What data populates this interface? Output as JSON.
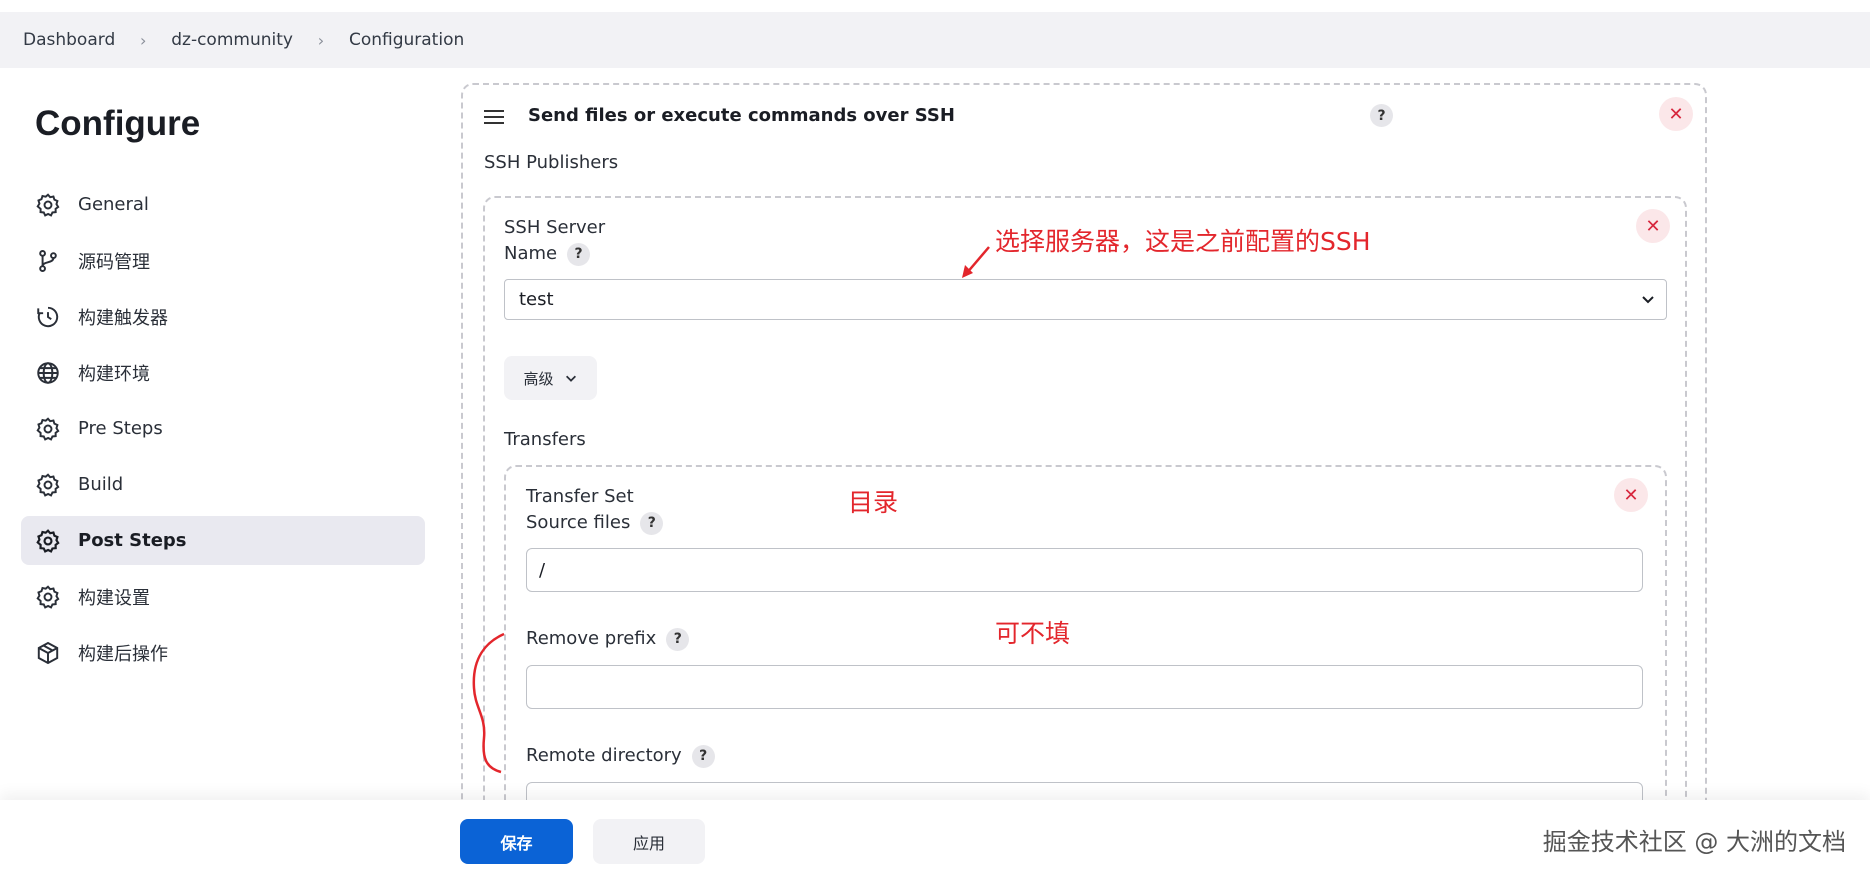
{
  "breadcrumb": [
    "Dashboard",
    "dz-community",
    "Configuration"
  ],
  "page_title": "Configure",
  "sidebar": {
    "items": [
      {
        "label": "General",
        "icon": "gear-icon",
        "active": false
      },
      {
        "label": "源码管理",
        "icon": "branch-icon",
        "active": false
      },
      {
        "label": "构建触发器",
        "icon": "clock-icon",
        "active": false
      },
      {
        "label": "构建环境",
        "icon": "globe-icon",
        "active": false
      },
      {
        "label": "Pre Steps",
        "icon": "gear-icon",
        "active": false
      },
      {
        "label": "Build",
        "icon": "gear-icon",
        "active": false
      },
      {
        "label": "Post Steps",
        "icon": "gear-icon",
        "active": true
      },
      {
        "label": "构建设置",
        "icon": "gear-icon",
        "active": false
      },
      {
        "label": "构建后操作",
        "icon": "package-icon",
        "active": false
      }
    ]
  },
  "panel": {
    "title": "Send files or execute commands over SSH",
    "help": "?",
    "ssh_publishers_label": "SSH Publishers",
    "server": {
      "label_line1": "SSH Server",
      "label_line2": "Name",
      "selected_value": "test",
      "advanced_label": "高级"
    },
    "transfers_label": "Transfers",
    "transfer": {
      "label_line1": "Transfer Set",
      "source_files_label": "Source files",
      "source_files_value": "/",
      "remove_prefix_label": "Remove prefix",
      "remove_prefix_value": "",
      "remote_directory_label": "Remote directory",
      "remote_directory_value": ""
    }
  },
  "annotations": {
    "server_note": "选择服务器，这是之前配置的SSH",
    "dir_note": "目录",
    "optional_note": "可不填"
  },
  "footer": {
    "save_label": "保存",
    "apply_label": "应用",
    "watermark": "掘金技术社区 @ 大洲的文档"
  },
  "colors": {
    "primary": "#0b63d6",
    "annotation": "#e3262c",
    "close": "#d7263d"
  }
}
